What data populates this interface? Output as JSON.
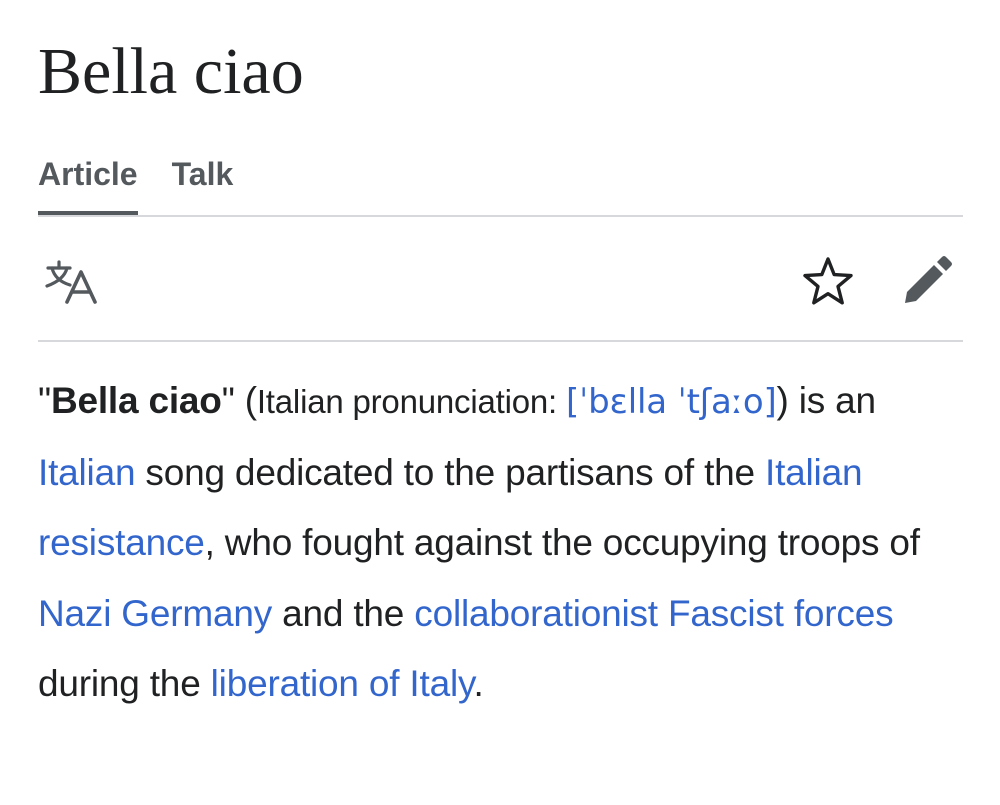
{
  "page": {
    "title": "Bella ciao"
  },
  "tabs": [
    {
      "label": "Article",
      "active": true
    },
    {
      "label": "Talk",
      "active": false
    }
  ],
  "toolbar": {
    "language_icon": "translate-icon",
    "watch_icon": "star-icon",
    "edit_icon": "pencil-icon"
  },
  "lead": {
    "quote_open": "\"",
    "bold_title": "Bella ciao",
    "quote_close": "\" ",
    "paren_open": "(",
    "pronunciation_label": "Italian pronunciation: ",
    "ipa_link": "[ˈbɛlla ˈtʃaːo]",
    "paren_close": ") is",
    "text_1": " an ",
    "link_italian": "Italian",
    "text_2": " song dedicated to the partisans of the ",
    "link_resistance": "Italian resistance",
    "text_3": ", who fought against the occupying troops of ",
    "link_nazi": "Nazi Germany",
    "text_4": " and the ",
    "link_fascist": "collaborationist Fascist forces",
    "text_5": " during the ",
    "link_liberation": "liberation of Italy",
    "text_6": "."
  },
  "colors": {
    "link": "#3366cc",
    "text": "#202122",
    "tab": "#54595d",
    "divider": "#d6d8db"
  }
}
